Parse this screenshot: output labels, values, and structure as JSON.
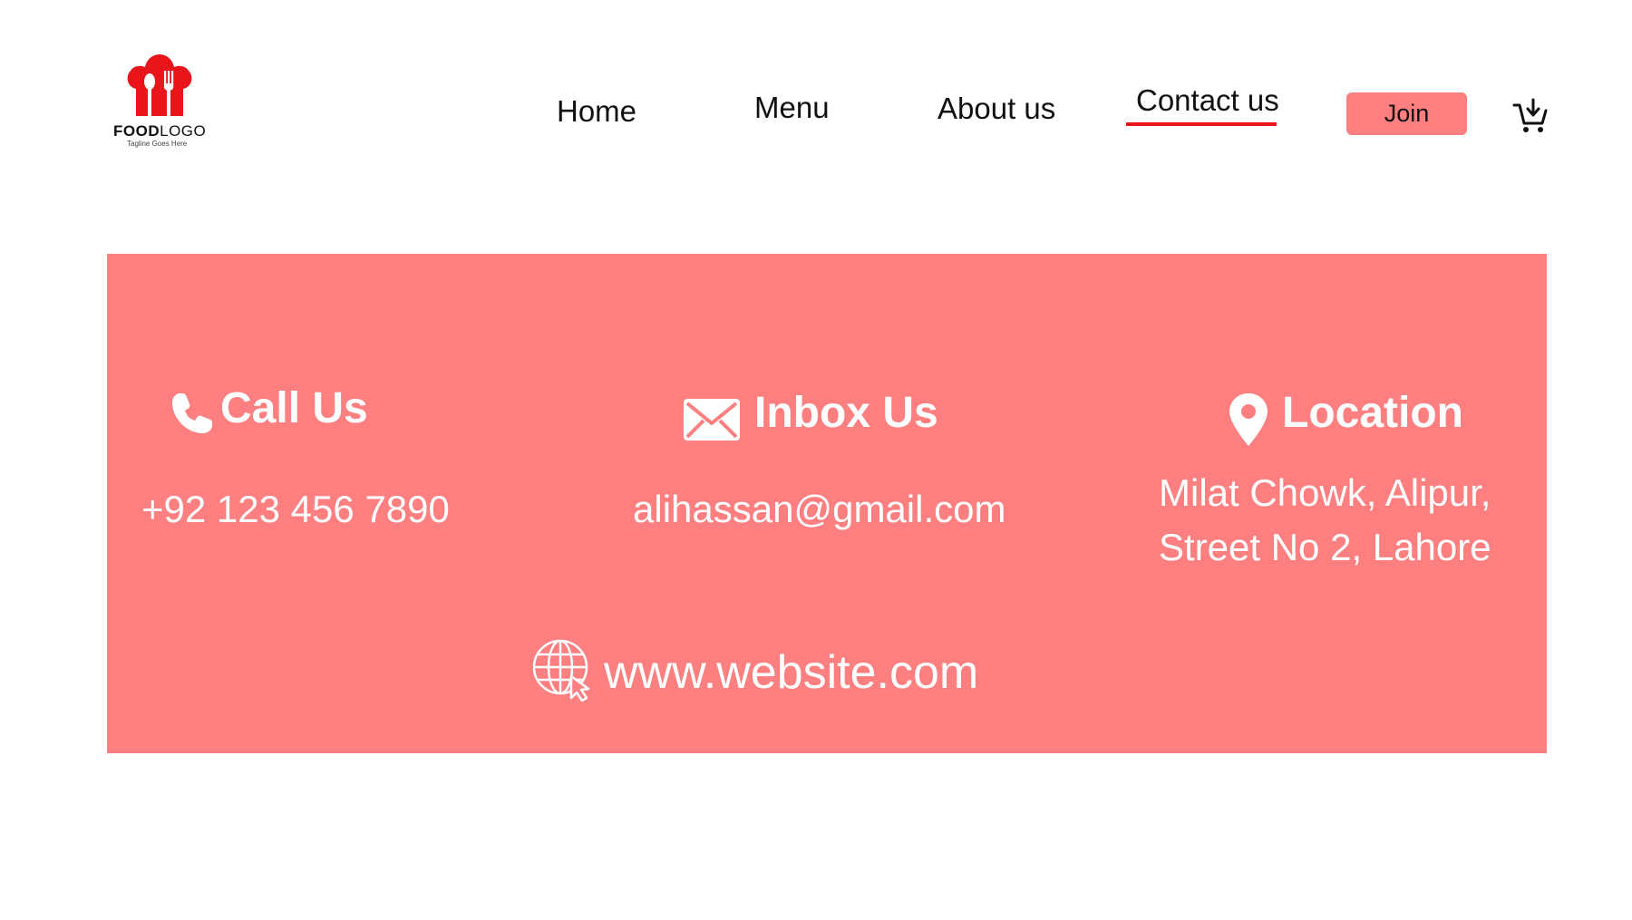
{
  "header": {
    "logo": {
      "brand_bold": "FOOD",
      "brand_light": "LOGO",
      "tagline": "Tagline Goes Here",
      "color": "#e8151b"
    },
    "nav": {
      "home": "Home",
      "menu": "Menu",
      "about": "About us",
      "contact": "Contact us",
      "active": "contact",
      "active_color": "#e8151b"
    },
    "join_label": "Join",
    "cart_icon": "cart-add-icon"
  },
  "contact": {
    "panel_color": "#fe7f80",
    "call": {
      "heading": "Call Us",
      "value": "+92 123 456 7890",
      "icon": "phone-icon"
    },
    "inbox": {
      "heading": "Inbox Us",
      "value": "alihassan@gmail.com",
      "icon": "mail-icon"
    },
    "location": {
      "heading": "Location",
      "line1": "Milat Chowk, Alipur,",
      "line2": "Street No 2, Lahore",
      "icon": "map-pin-icon"
    },
    "website": {
      "value": "www.website.com",
      "icon": "globe-icon"
    }
  }
}
